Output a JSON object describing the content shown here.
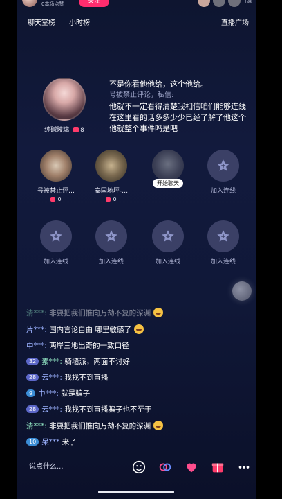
{
  "top": {
    "host_sub": "0本场点赞",
    "follow_label": "关注",
    "viewer_count": "68"
  },
  "tabs": {
    "chat_rank": "聊天室榜",
    "hour_rank": "小时榜",
    "live_square": "直播广场"
  },
  "host": {
    "name": "纯碱玻璃",
    "likes": "8"
  },
  "caption": {
    "line1": "不是你看他他给，这个他给。",
    "line2": "号被禁止评论，私信:",
    "line3": "他就不一定看得清楚我相信咱们能够连线在这里看的话多多少少已经了解了他这个他就整个事件吗是吧"
  },
  "seats": [
    {
      "label": "号被禁止评…",
      "likes": "0"
    },
    {
      "label": "泰国地坪-…",
      "likes": "0"
    },
    {
      "label": "开始聊天"
    },
    {
      "label": "加入连线"
    },
    {
      "label": "加入连线"
    },
    {
      "label": "加入连线"
    },
    {
      "label": "加入连线"
    },
    {
      "label": "加入连线"
    }
  ],
  "comments": [
    {
      "badge": "",
      "user": "清***:",
      "text": "非要把我们推向万劫不复的深渊",
      "emoji": true,
      "dim": true
    },
    {
      "badge": "",
      "user": "片***:",
      "text": "国内言论自由 哪里敏感了",
      "emoji": true
    },
    {
      "badge": "",
      "user": "中***:",
      "text": "两岸三地出奇的一致口径"
    },
    {
      "badge": "32",
      "user": "素***:",
      "text": "骑墙派，两面不讨好"
    },
    {
      "badge": "28",
      "user": "云***:",
      "text": "我找不到直播"
    },
    {
      "badge": "9",
      "user": "中***:",
      "text": "就是骗子"
    },
    {
      "badge": "28",
      "user": "云***:",
      "text": "我找不到直播骗子也不至于"
    },
    {
      "badge": "",
      "user": "清***:",
      "text": "非要把我们推向万劫不复的深渊",
      "emoji": true
    },
    {
      "badge": "10",
      "user": "呆***",
      "text": "来了"
    }
  ],
  "bottom": {
    "say_placeholder": "说点什么..."
  },
  "colors": {
    "accent": "#ff2d6e",
    "background": "#121a3d"
  }
}
